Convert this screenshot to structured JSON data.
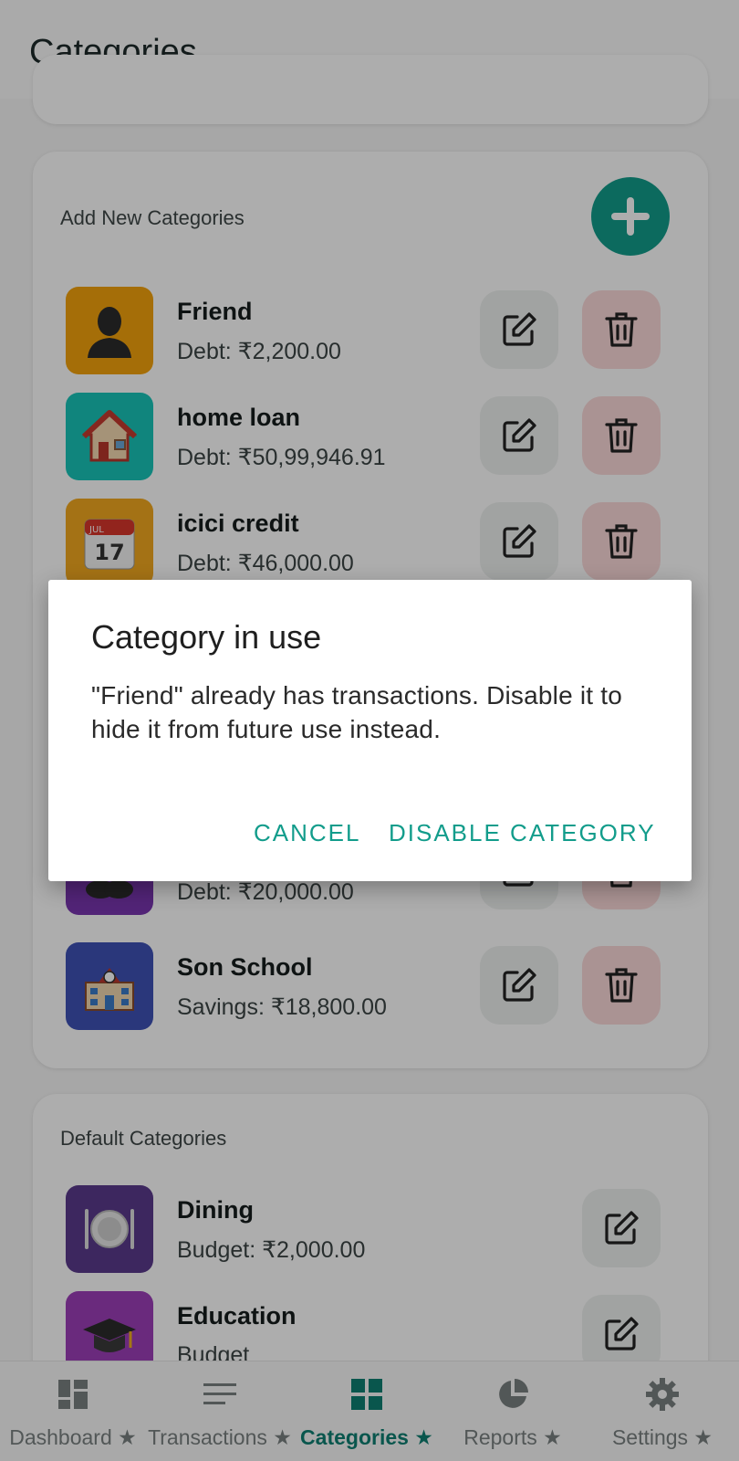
{
  "header": {
    "title": "Categories"
  },
  "custom_section": {
    "label": "Add New Categories",
    "items": [
      {
        "name": "Friend",
        "sub": "Debt: ₹2,200.00",
        "icon": "person-silhouette-icon",
        "bg": "#f4a30c"
      },
      {
        "name": "home loan",
        "sub": "Debt: ₹50,99,946.91",
        "icon": "house-icon",
        "bg": "#18c5b9"
      },
      {
        "name": "icici credit",
        "sub": "Debt: ₹46,000.00",
        "icon": "calendar-icon",
        "bg": "#f2a81f",
        "cal_month": "JUL",
        "cal_day": "17"
      },
      {
        "name": "",
        "sub": "Debt: ₹20,000.00",
        "icon": "people-icon",
        "bg": "#7a36b0"
      },
      {
        "name": "Son School",
        "sub": "Savings: ₹18,800.00",
        "icon": "school-building-icon",
        "bg": "#3f51b5"
      }
    ]
  },
  "default_section": {
    "label": "Default Categories",
    "items": [
      {
        "name": "Dining",
        "sub": "Budget: ₹2,000.00",
        "icon": "plate-cutlery-icon",
        "bg": "#5b3a8c"
      },
      {
        "name": "Education",
        "sub": "Budget",
        "icon": "graduation-cap-icon",
        "bg": "#9c3fb8"
      }
    ]
  },
  "dialog": {
    "title": "Category in use",
    "message": "\"Friend\" already has transactions. Disable it to hide it from future use instead.",
    "cancel": "CANCEL",
    "confirm": "DISABLE CATEGORY"
  },
  "nav": [
    {
      "label": "Dashboard ★",
      "icon": "dashboard-icon"
    },
    {
      "label": "Transactions ★",
      "icon": "list-lines-icon"
    },
    {
      "label": "Categories ★",
      "icon": "grid-icon",
      "active": true
    },
    {
      "label": "Reports ★",
      "icon": "pie-chart-icon"
    },
    {
      "label": "Settings ★",
      "icon": "gear-icon"
    }
  ],
  "colors": {
    "accent": "#129c8b",
    "active_nav": "#0e7f72",
    "delete_bg": "#fbd9d9",
    "edit_bg": "#edf0ef"
  }
}
